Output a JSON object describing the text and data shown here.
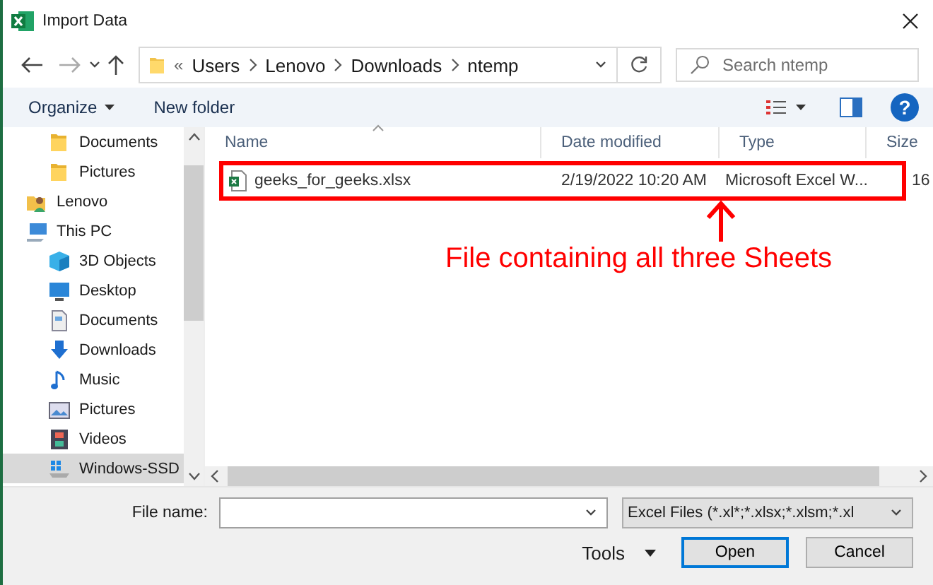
{
  "window": {
    "title": "Import Data"
  },
  "nav": {
    "overflow": "«",
    "crumbs": [
      "Users",
      "Lenovo",
      "Downloads",
      "ntemp"
    ],
    "search": {
      "placeholder": "Search ntemp"
    }
  },
  "toolbar": {
    "organize": "Organize",
    "new_folder": "New folder",
    "help": "?"
  },
  "sidebar": {
    "group_tail": [
      {
        "label": "Documents",
        "kind": "folder",
        "selected": false
      },
      {
        "label": "Pictures",
        "kind": "folder",
        "selected": false
      }
    ],
    "items": [
      {
        "label": "Lenovo",
        "kind": "user",
        "selected": false
      },
      {
        "label": "This PC",
        "kind": "pc",
        "selected": false,
        "children": [
          {
            "label": "3D Objects",
            "kind": "cube",
            "selected": false
          },
          {
            "label": "Desktop",
            "kind": "desktop",
            "selected": false
          },
          {
            "label": "Documents",
            "kind": "document",
            "selected": false
          },
          {
            "label": "Downloads",
            "kind": "download",
            "selected": false
          },
          {
            "label": "Music",
            "kind": "music",
            "selected": false
          },
          {
            "label": "Pictures",
            "kind": "pictures",
            "selected": false
          },
          {
            "label": "Videos",
            "kind": "video",
            "selected": false
          },
          {
            "label": "Windows-SSD",
            "kind": "drive",
            "selected": true
          }
        ]
      }
    ]
  },
  "table": {
    "columns": [
      "Name",
      "Date modified",
      "Type",
      "Size"
    ],
    "rows": [
      {
        "name": "geeks_for_geeks.xlsx",
        "date_modified": "2/19/2022 10:20 AM",
        "type": "Microsoft Excel W...",
        "size": "16"
      }
    ]
  },
  "annotation": {
    "text": "File containing all three Sheets"
  },
  "footer": {
    "file_name_label": "File name:",
    "filter": "Excel Files (*.xl*;*.xlsx;*.xlsm;*.xl",
    "tools": "Tools",
    "buttons": [
      "Open",
      "Cancel"
    ]
  }
}
